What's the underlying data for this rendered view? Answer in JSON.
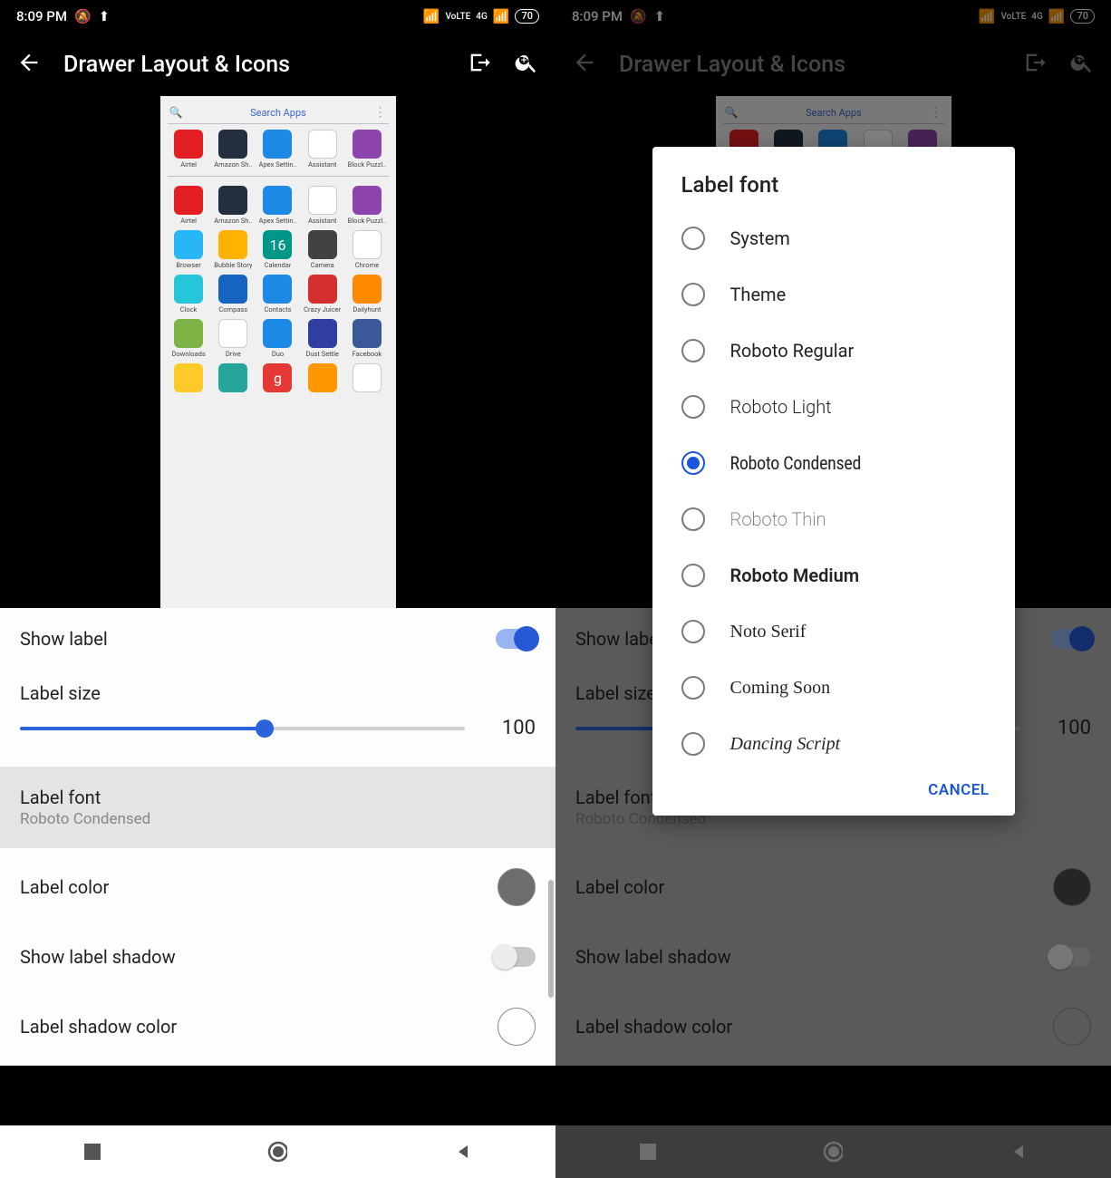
{
  "status": {
    "time": "8:09 PM",
    "mute_icon": "bell-off",
    "upload_icon": "upload",
    "wifi_icon": "wifi",
    "volte": "VoLTE",
    "signal": "4G",
    "battery": "70"
  },
  "header": {
    "title": "Drawer Layout & Icons",
    "back_icon": "arrow-back",
    "share_icon": "share-box",
    "zoom_icon": "zoom-in"
  },
  "preview": {
    "search_placeholder": "Search Apps",
    "recent_apps": [
      {
        "label": "Airtel",
        "color": "#e31e23"
      },
      {
        "label": "Amazon Sh..",
        "color": "#232f3e"
      },
      {
        "label": "Apex Settin..",
        "color": "#1e88e5"
      },
      {
        "label": "Assistant",
        "color": "#ffffff"
      },
      {
        "label": "Block Puzzl..",
        "color": "#8e44ad"
      }
    ],
    "all_apps": [
      {
        "label": "Airtel",
        "color": "#e31e23"
      },
      {
        "label": "Amazon Sh..",
        "color": "#232f3e"
      },
      {
        "label": "Apex Settin..",
        "color": "#1e88e5"
      },
      {
        "label": "Assistant",
        "color": "#ffffff"
      },
      {
        "label": "Block Puzzl..",
        "color": "#8e44ad"
      },
      {
        "label": "Browser",
        "color": "#29b6f6"
      },
      {
        "label": "Bubble Story",
        "color": "#ffb300"
      },
      {
        "label": "Calendar",
        "color": "#009688",
        "text": "16"
      },
      {
        "label": "Camera",
        "color": "#424242"
      },
      {
        "label": "Chrome",
        "color": "#ffffff"
      },
      {
        "label": "Clock",
        "color": "#26c6da"
      },
      {
        "label": "Compass",
        "color": "#1565c0"
      },
      {
        "label": "Contacts",
        "color": "#1e88e5"
      },
      {
        "label": "Crazy Juicer",
        "color": "#d32f2f"
      },
      {
        "label": "Dailyhunt",
        "color": "#ff8a00"
      },
      {
        "label": "Downloads",
        "color": "#7cb342"
      },
      {
        "label": "Drive",
        "color": "#ffffff"
      },
      {
        "label": "Duo",
        "color": "#1e88e5"
      },
      {
        "label": "Dust Settle",
        "color": "#303f9f"
      },
      {
        "label": "Facebook",
        "color": "#3b5998"
      },
      {
        "label": "",
        "color": "#ffca28"
      },
      {
        "label": "",
        "color": "#26a69a"
      },
      {
        "label": "",
        "color": "#e53935",
        "text": "g"
      },
      {
        "label": "",
        "color": "#ff9800"
      },
      {
        "label": "",
        "color": "#ffffff"
      }
    ]
  },
  "settings": {
    "show_label": {
      "title": "Show label",
      "on": true
    },
    "label_size": {
      "title": "Label size",
      "value": "100"
    },
    "label_font": {
      "title": "Label font",
      "value": "Roboto Condensed"
    },
    "label_color": {
      "title": "Label color",
      "color": "#6d6d6d"
    },
    "show_shadow": {
      "title": "Show label shadow",
      "on": false
    },
    "shadow_color": {
      "title": "Label shadow color",
      "color": "#ffffff"
    }
  },
  "dialog": {
    "title": "Label font",
    "options": [
      {
        "label": "System",
        "style": ""
      },
      {
        "label": "Theme",
        "style": ""
      },
      {
        "label": "Roboto Regular",
        "style": ""
      },
      {
        "label": "Roboto Light",
        "style": "light"
      },
      {
        "label": "Roboto Condensed",
        "style": "condensed",
        "selected": true
      },
      {
        "label": "Roboto Thin",
        "style": "thin"
      },
      {
        "label": "Roboto Medium",
        "style": "medium"
      },
      {
        "label": "Noto Serif",
        "style": "serif"
      },
      {
        "label": "Coming Soon",
        "style": "comic"
      },
      {
        "label": "Dancing Script",
        "style": "script"
      }
    ],
    "cancel": "CANCEL"
  },
  "nav": {
    "recents": "recents",
    "home": "home",
    "back": "back"
  }
}
